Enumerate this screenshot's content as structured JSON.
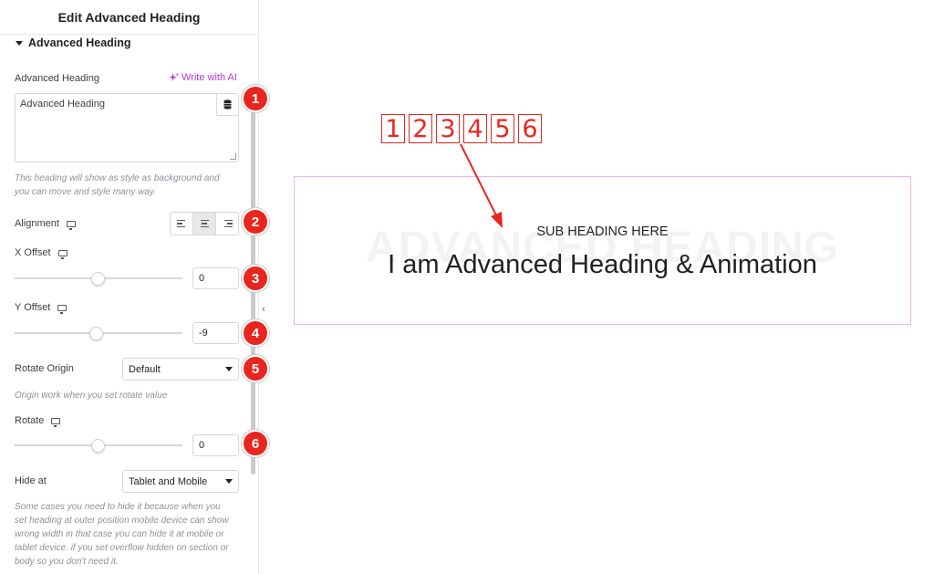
{
  "panel": {
    "title": "Edit Advanced Heading",
    "section_title": "Advanced Heading",
    "heading_field": {
      "label": "Advanced Heading",
      "ai_label": "Write with AI",
      "value": "Advanced Heading",
      "description_line1": "This heading will show as style as background and",
      "description_line2": "you can move and style many way."
    },
    "alignment": {
      "label": "Alignment",
      "selected": "center"
    },
    "x_offset": {
      "label": "X Offset",
      "value": "0",
      "slider_fraction": 0.5
    },
    "y_offset": {
      "label": "Y Offset",
      "value": "-9",
      "slider_fraction": 0.48
    },
    "rotate_origin": {
      "label": "Rotate Origin",
      "value": "Default",
      "description": "Origin work when you set rotate value"
    },
    "rotate": {
      "label": "Rotate",
      "value": "0",
      "slider_fraction": 0.5
    },
    "hide_at": {
      "label": "Hide at",
      "value": "Tablet and Mobile",
      "description_lines": [
        "Some cases you need to hide it because when you",
        "set heading at outer position mobile device can show",
        "wrong width in that case you can hide it at mobile or",
        "tablet device. if you set overflow hidden on section or",
        "body so you don't need it."
      ]
    }
  },
  "callouts": [
    "1",
    "2",
    "3",
    "4",
    "5",
    "6"
  ],
  "annotation_boxes": [
    "1",
    "2",
    "3",
    "4",
    "5",
    "6"
  ],
  "preview": {
    "background_heading": "ADVANCED HEADING",
    "sub_heading": "SUB HEADING HERE",
    "main_heading": "I am Advanced Heading & Animation"
  },
  "colors": {
    "accent_ai": "#b636d6",
    "callout_red": "#e8261f",
    "preview_border": "#f0b3ee"
  }
}
